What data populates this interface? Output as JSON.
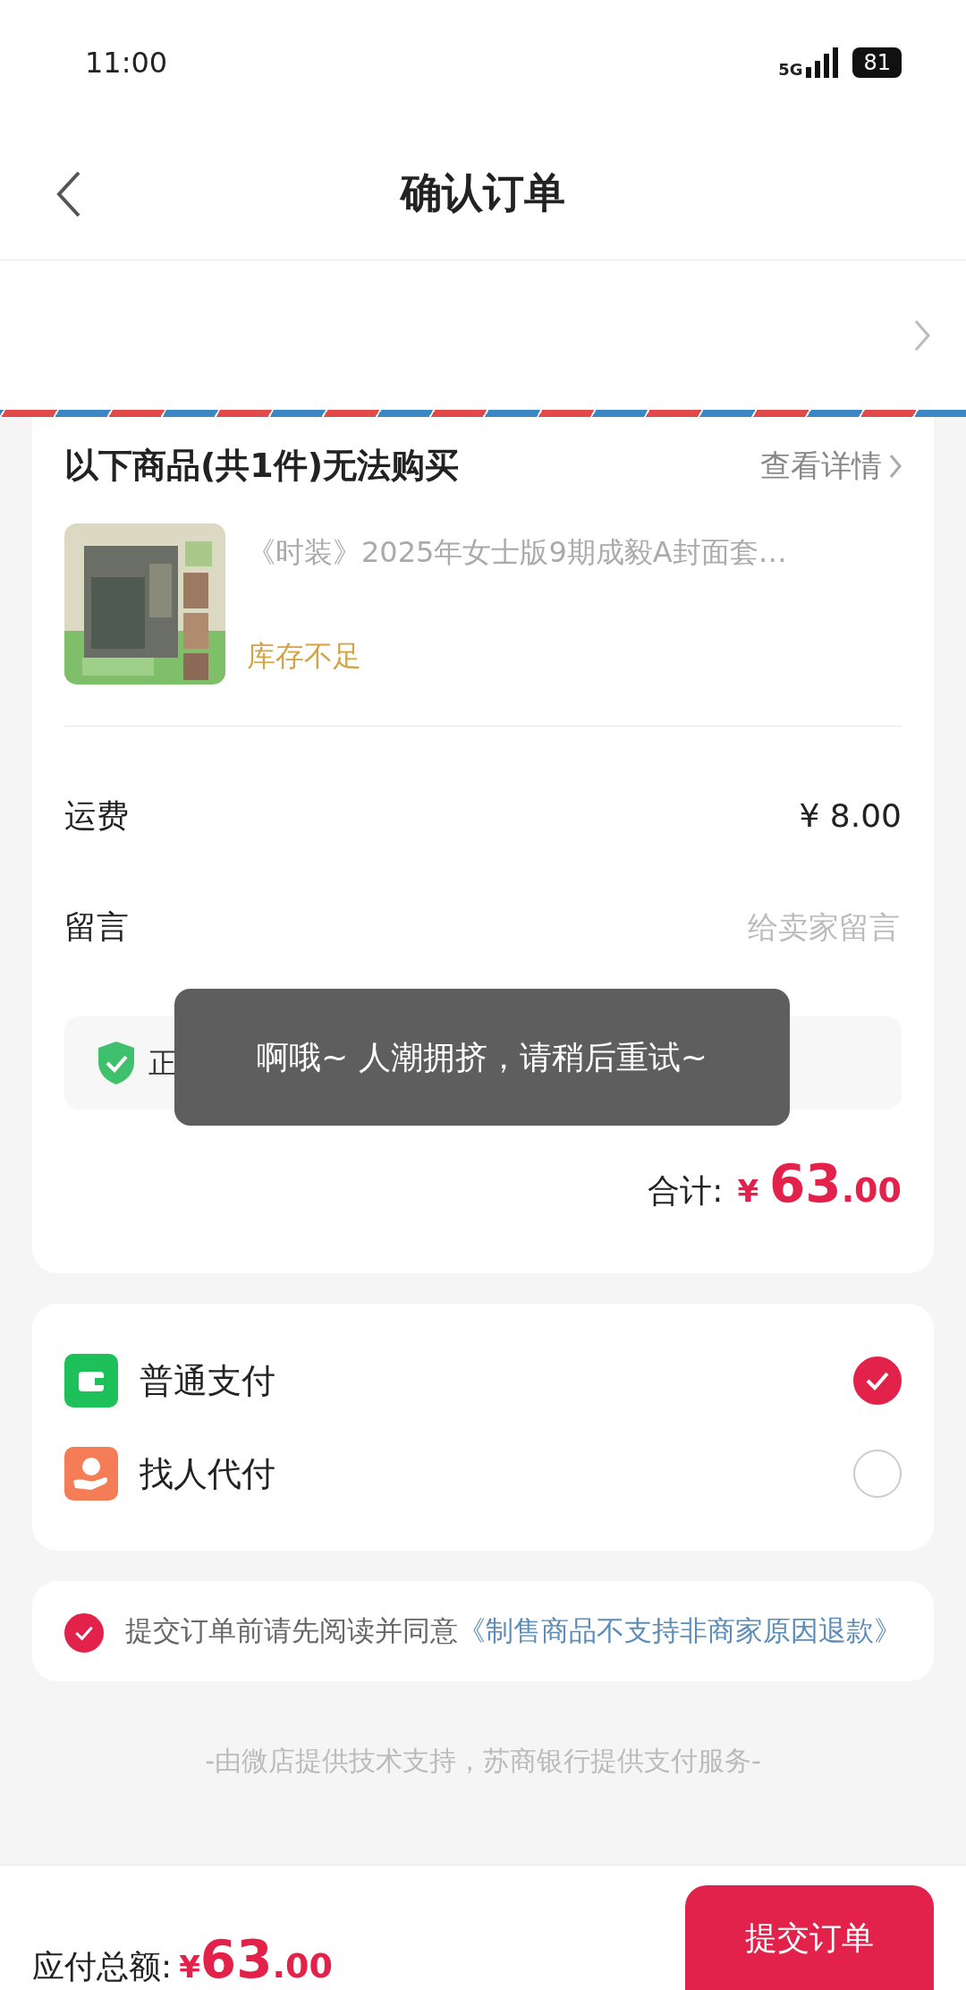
{
  "status_bar": {
    "time": "11:00",
    "network": "5G",
    "battery": "81"
  },
  "header": {
    "title": "确认订单"
  },
  "unavailable": {
    "title": "以下商品(共1件)无法购买",
    "details_link": "查看详情",
    "items": [
      {
        "kind": "picture",
        "name": "《时装》2025年女士版9期成毅A封面套…",
        "status": "库存不足"
      }
    ]
  },
  "fees": [
    {
      "label": "运费",
      "value": "¥ 8.00"
    }
  ],
  "message": {
    "label": "留言",
    "placeholder": "给卖家留言"
  },
  "assurance": {
    "text": "正"
  },
  "toast": {
    "text": "啊哦~ 人潮拥挤，请稍后重试~"
  },
  "subtotal": {
    "label": "合计:",
    "currency": "¥",
    "integer": "63",
    "decimal": ".00"
  },
  "payment_methods": [
    {
      "kind": "wallet",
      "label": "普通支付",
      "selected": true
    },
    {
      "kind": "hand",
      "label": "找人代付",
      "selected": false
    }
  ],
  "agreement": {
    "checked": true,
    "text": "提交订单前请先阅读并同意",
    "link": "《制售商品不支持非商家原因退款》"
  },
  "footer": "-由微店提供技术支持，苏商银行提供支付服务-",
  "bottom_bar": {
    "label": "应付总额:",
    "currency": "¥",
    "integer": "63",
    "decimal": ".00",
    "button": "提交订单"
  }
}
